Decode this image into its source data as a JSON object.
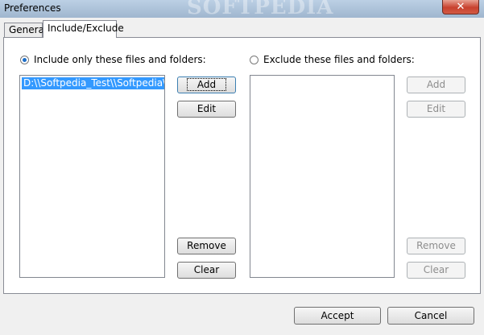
{
  "window": {
    "title": "Preferences",
    "watermark": "SOFTPEDIA",
    "close_glyph": "✕"
  },
  "tabs": [
    {
      "label": "General",
      "active": false
    },
    {
      "label": "Include/Exclude",
      "active": true
    }
  ],
  "include": {
    "radio_label": "Include only these files and folders:",
    "selected": true,
    "items": [
      "D:\\\\Softpedia_Test\\\\Softpedia\\cust"
    ],
    "buttons": {
      "add": "Add",
      "edit": "Edit",
      "remove": "Remove",
      "clear": "Clear"
    }
  },
  "exclude": {
    "radio_label": "Exclude these files and folders:",
    "selected": false,
    "items": [],
    "buttons": {
      "add": "Add",
      "edit": "Edit",
      "remove": "Remove",
      "clear": "Clear"
    }
  },
  "footer": {
    "accept": "Accept",
    "cancel": "Cancel"
  }
}
